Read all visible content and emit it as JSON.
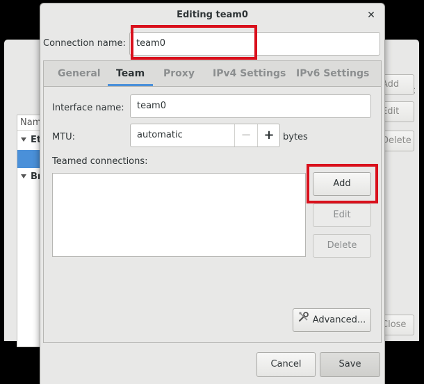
{
  "background_window": {
    "list_header": "Name",
    "groups": [
      "Eth",
      "Br"
    ],
    "buttons": [
      "Add",
      "Edit",
      "Delete"
    ],
    "close_button": "Close",
    "close_icon": "×"
  },
  "dialog": {
    "title": "Editing team0",
    "close_icon": "✕",
    "connection_name_label": "Connection name:",
    "connection_name_value": "team0",
    "tabs": [
      {
        "label": "General"
      },
      {
        "label": "Team"
      },
      {
        "label": "Proxy"
      },
      {
        "label": "IPv4 Settings"
      },
      {
        "label": "IPv6 Settings"
      }
    ],
    "active_tab": "Team",
    "team": {
      "interface_name_label": "Interface name:",
      "interface_name_value": "team0",
      "mtu_label": "MTU:",
      "mtu_value": "automatic",
      "mtu_minus": "−",
      "mtu_plus": "+",
      "mtu_unit": "bytes",
      "teamed_connections_label": "Teamed connections:",
      "teamed_connections": [],
      "add_button": "Add",
      "edit_button": "Edit",
      "delete_button": "Delete",
      "advanced_button": "Advanced..."
    },
    "cancel_button": "Cancel",
    "save_button": "Save"
  },
  "colors": {
    "highlight": "#d9101c",
    "accent": "#4a90d9"
  }
}
